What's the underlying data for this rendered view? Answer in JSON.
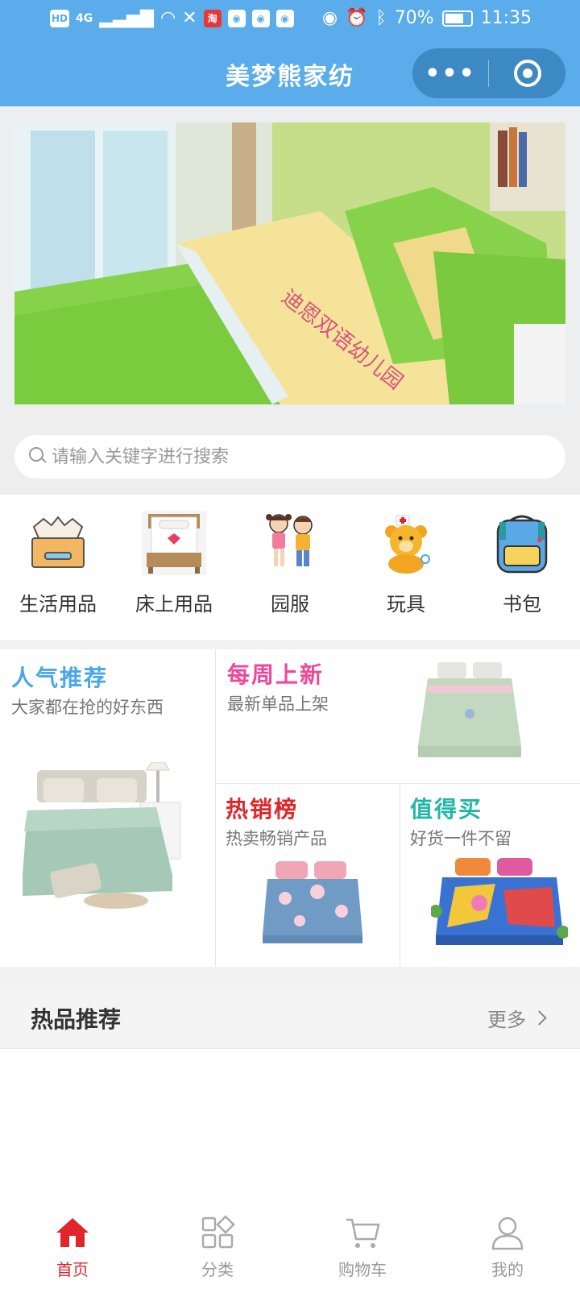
{
  "status_bar": {
    "left_icons": [
      "HD",
      "4G"
    ],
    "battery": "70%",
    "time": "11:35"
  },
  "nav": {
    "title": "美梦熊家纺",
    "more_label": "•••"
  },
  "banner": {
    "pillow_text": "迪恩双语幼儿园"
  },
  "search": {
    "placeholder": "请输入关键字进行搜索"
  },
  "categories": [
    {
      "label": "生活用品",
      "icon": "tissue-box-icon"
    },
    {
      "label": "床上用品",
      "icon": "bed-icon"
    },
    {
      "label": "园服",
      "icon": "kids-icon"
    },
    {
      "label": "玩具",
      "icon": "teddy-bear-icon"
    },
    {
      "label": "书包",
      "icon": "schoolbag-icon"
    }
  ],
  "promos": {
    "popular": {
      "title": "人气推荐",
      "subtitle": "大家都在抢的好东西",
      "color": "#4aa7e8"
    },
    "weekly": {
      "title": "每周上新",
      "subtitle": "最新单品上架",
      "color": "#f0479b"
    },
    "bestseller": {
      "title": "热销榜",
      "subtitle": "热卖畅销产品",
      "color": "#e0262a"
    },
    "worth": {
      "title": "值得买",
      "subtitle": "好货一件不留",
      "color": "#20b6a8"
    }
  },
  "hot_section": {
    "title": "热品推荐",
    "more_label": "更多"
  },
  "tabbar": [
    {
      "label": "首页",
      "icon": "home-icon",
      "active": true
    },
    {
      "label": "分类",
      "icon": "category-icon",
      "active": false
    },
    {
      "label": "购物车",
      "icon": "cart-icon",
      "active": false
    },
    {
      "label": "我的",
      "icon": "user-icon",
      "active": false
    }
  ],
  "colors": {
    "nav_bg": "#5aacea",
    "active_tab": "#e0262a"
  }
}
